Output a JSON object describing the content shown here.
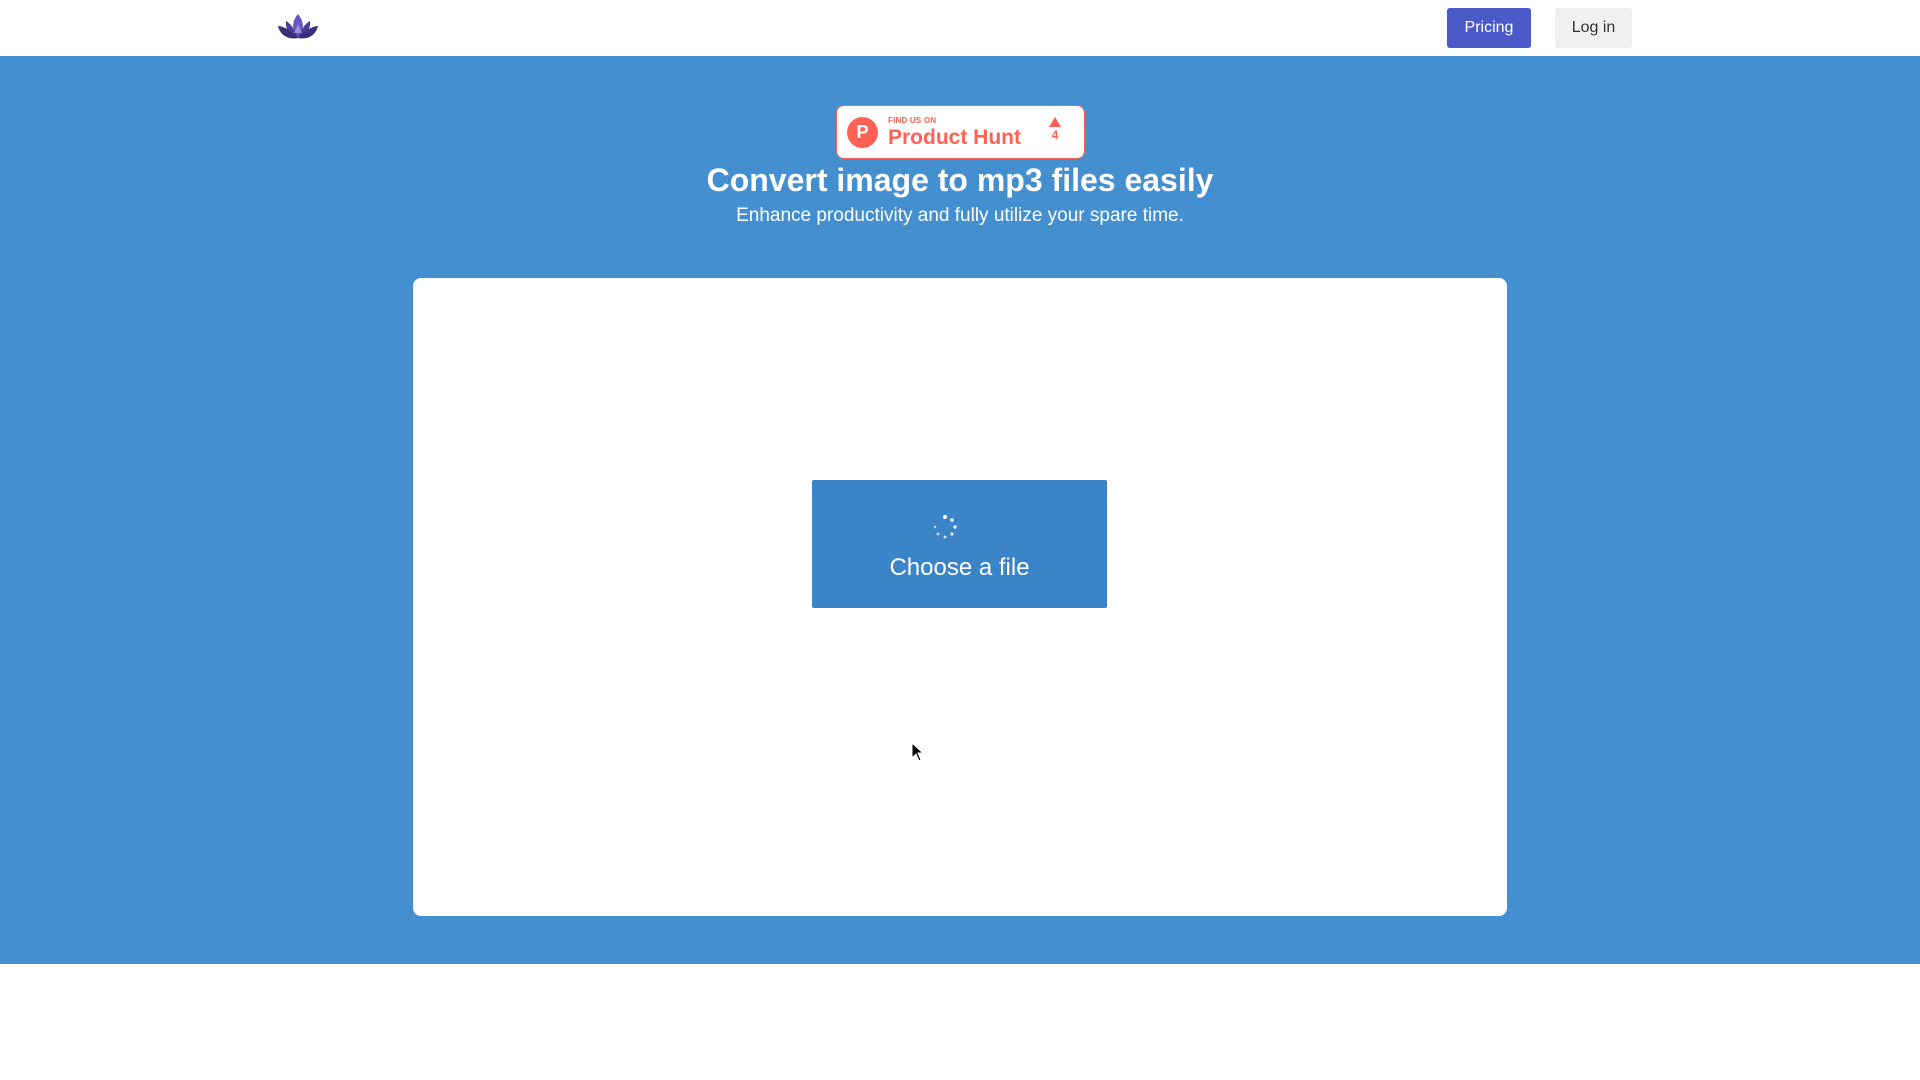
{
  "header": {
    "logo_icon": "lotus-icon",
    "pricing_label": "Pricing",
    "login_label": "Log in"
  },
  "product_hunt": {
    "small_text": "FIND US ON",
    "big_text": "Product Hunt",
    "logo_letter": "P",
    "upvote_count": "4",
    "color": "#ff6154"
  },
  "hero": {
    "title": "Convert image to mp3 files easily",
    "subtitle": "Enhance productivity and fully utilize your spare time."
  },
  "upload": {
    "button_label": "Choose a file",
    "spinner_icon": "loading-spinner-icon"
  },
  "colors": {
    "hero_background": "#438fd0",
    "pricing_button": "#4a5bc9",
    "upload_button": "#3b84c8",
    "login_button": "#f0f0f0"
  }
}
